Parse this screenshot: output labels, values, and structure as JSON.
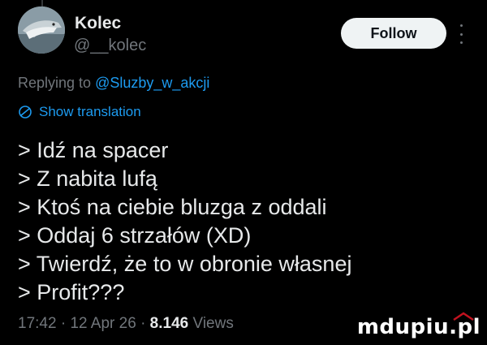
{
  "author": {
    "display_name": "Kolec",
    "handle": "@__kolec"
  },
  "follow_label": "Follow",
  "reply": {
    "prefix": "Replying to",
    "mention": "@Sluzby_w_akcji"
  },
  "translation_label": "Show translation",
  "tweet_lines": [
    "> Idź na spacer",
    "> Z nabita lufą",
    "> Ktoś na ciebie bluzga z oddali",
    "> Oddaj 6 strzałów (XD)",
    "> Twierdź, że to w obronie własnej",
    "> Profit???"
  ],
  "meta": {
    "time": "17:42",
    "date": "12 Apr 26",
    "views_count": "8.146",
    "views_label": "Views"
  },
  "watermark": "mdupiu.pl",
  "colors": {
    "background": "#000000",
    "text": "#e7e9ea",
    "muted": "#71767b",
    "link": "#1d9bf0",
    "follow_bg": "#eff3f4"
  },
  "icons": {
    "more": "more-dots-icon",
    "translate": "translate-globe-icon"
  }
}
